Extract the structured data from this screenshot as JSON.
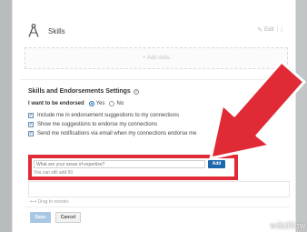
{
  "skills": {
    "title": "Skills",
    "edit_label": "Edit",
    "add_skills_label": "+ Add skills"
  },
  "settings": {
    "title": "Skills and Endorsements Settings",
    "endorsed_label": "I want to be endorsed",
    "option_yes": "Yes",
    "option_no": "No",
    "selected_option": "Yes",
    "checkboxes": [
      {
        "label": "Include me in endorsement suggestions to my connections",
        "checked": true
      },
      {
        "label": "Show me suggestions to endorse my connections",
        "checked": true
      },
      {
        "label": "Send me notifications via email when my connections endorse me",
        "checked": true
      }
    ]
  },
  "expertise": {
    "placeholder": "What are your areas of expertise?",
    "add_label": "Add",
    "note": "You can still add 50"
  },
  "drag_hint": "Drag to reorder.",
  "buttons": {
    "save": "Save",
    "cancel": "Cancel"
  },
  "watermark": "wikiHow",
  "colors": {
    "accent": "#1c67ad",
    "highlight": "#e02a35",
    "background": "#cfd2d3"
  },
  "icons": {
    "skills": "compass-icon",
    "edit": "pencil-icon",
    "reorder": "grip-icon",
    "help": "question-icon",
    "drag": "drag-arrows-icon"
  }
}
